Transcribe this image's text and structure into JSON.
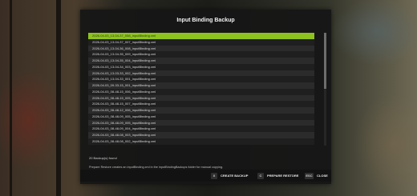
{
  "dialog": {
    "title": "Input Binding Backup",
    "backup_count_text": "20 Backup(s) found",
    "hint_text": "Prepare Restore creates an inputBinding.xml in the inputBindingBackups folder for manual copying."
  },
  "backups": [
    "2026-04-03_13-04-37_058_inputBinding.xml",
    "2026-04-03_13-04-37_007_inputBinding.xml",
    "2026-04-03_13-04-36_008_inputBinding.xml",
    "2026-04-03_13-04-35_009_inputBinding.xml",
    "2026-04-03_13-04-35_004_inputBinding.xml",
    "2026-04-03_13-04-34_003_inputBinding.xml",
    "2026-04-03_13-03-33_002_inputBinding.xml",
    "2026-04-03_13-04-33_001_inputBinding.xml",
    "2026-04-03_09-33-15_001_inputBinding.xml",
    "2026-04-03_08-48-15_006_inputBinding.xml",
    "2026-04-03_08-48-15_005_inputBinding.xml",
    "2026-04-03_08-48-15_007_inputBinding.xml",
    "2026-04-03_08-48-12_006_inputBinding.xml",
    "2026-04-03_08-48-09_005_inputBinding.xml",
    "2026-04-03_08-48-09_005_inputBinding.xml",
    "2026-04-03_08-48-09_004_inputBinding.xml",
    "2026-04-03_08-48-08_003_inputBinding.xml",
    "2026-04-03_08-48-08_002_inputBinding.xml"
  ],
  "selected_index": 0,
  "footer": {
    "create": {
      "key": "X",
      "label": "CREATE BACKUP"
    },
    "prepare": {
      "key": "C",
      "label": "PREPARE RESTORE"
    },
    "close": {
      "key": "ESC",
      "label": "CLOSE"
    }
  },
  "colors": {
    "accent": "#8dc21f",
    "panel": "#161616"
  }
}
